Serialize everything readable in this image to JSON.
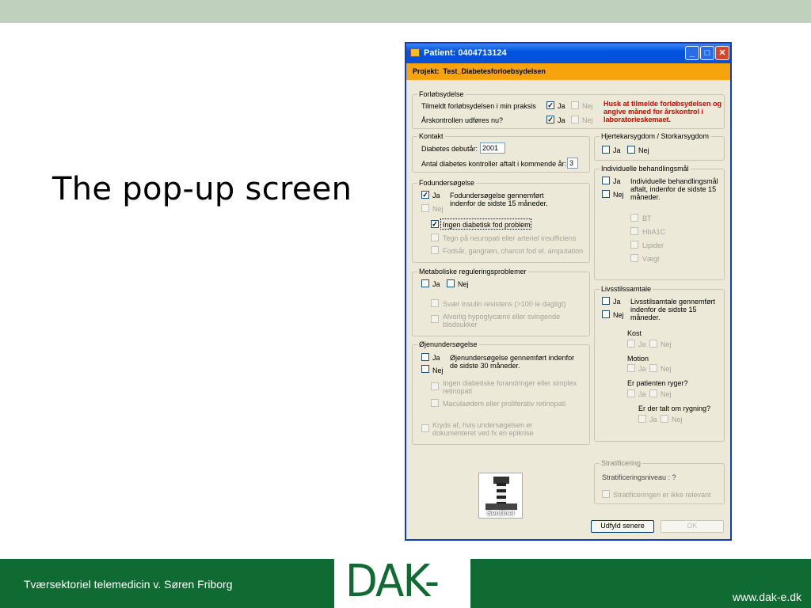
{
  "slide": {
    "title": "The pop-up screen",
    "footer_author": "Tværsektoriel telemedicin  v. Søren Friborg",
    "logo_text": "DAK-E",
    "footer_url": "www.dak-e.dk"
  },
  "window": {
    "title": "Patient: 0404713124",
    "project_label": "Projekt:",
    "project_name": "Test_Diabetesforloebsydelsen",
    "min_glyph": "_",
    "max_glyph": "□",
    "close_glyph": "✕"
  },
  "glyphs": {
    "check": "✓"
  },
  "forlob": {
    "legend": "Forløbsydelse",
    "q1": "Tilmeldt forløbsydelsen i min praksis",
    "q2": "Årskontrollen udføres nu?",
    "ja": "Ja",
    "nej": "Nej",
    "q1_ja": true,
    "q2_ja": true,
    "warning": "Husk at tilmelde forløbsydelsen og angive måned for årskontrol i laboratorieskemaet."
  },
  "kontakt": {
    "legend": "Kontakt",
    "debut_label": "Diabetes debutår:",
    "debut_value": "2001",
    "antal_label": "Antal diabetes kontroller aftalt i kommende år:",
    "antal_value": "3"
  },
  "fod": {
    "legend": "Fodundersøgelse",
    "ja": "Ja",
    "nej": "Nej",
    "ja_checked": true,
    "desc": "Fodundersøgelse gennemført indenfor de sidste 15 måneder.",
    "opt1": "Ingen diabetisk fod problem",
    "opt1_checked": true,
    "opt2": "Tegn på neuropati eller arteriel insufficiens",
    "opt3": "Fodsår, gangræn, charcot fod el. amputation"
  },
  "metab": {
    "legend": "Metaboliske reguleringsproblemer",
    "ja": "Ja",
    "nej": "Nej",
    "opt1": "Svær insulin resistens (>100 ie dagligt)",
    "opt2": "Alvorlig hypoglycæmi eller svingende blodsukker"
  },
  "ojen": {
    "legend": "Øjenundersøgelse",
    "ja": "Ja",
    "nej": "Nej",
    "desc": "Øjenundersøgelse gennemført indenfor de sidste 30 måneder.",
    "opt1": "Ingen diabetiske forandringer eller simplex retinopati",
    "opt2": "Maculaødem eller proliferativ retinopati",
    "opt3": "Kryds af, hvis undersøgelsen er dokumenteret ved fx en epikrise"
  },
  "hjerte": {
    "legend": "Hjertekarsygdom / Storkarsygdom",
    "ja": "Ja",
    "nej": "Nej"
  },
  "indiv": {
    "legend": "Individuelle behandlingsmål",
    "ja": "Ja",
    "nej": "Nej",
    "desc": "Individuelle behandlingsmål aftalt, indenfor de sidste 15 måneder.",
    "bt": "BT",
    "hba1c": "HbA1C",
    "lipider": "Lipider",
    "vaegt": "Vægt"
  },
  "livs": {
    "legend": "Livsstilssamtale",
    "ja": "Ja",
    "nej": "Nej",
    "desc": "Livsstilsamtale gennemført indenfor de sidste 15 måneder.",
    "kost": "Kost",
    "motion": "Motion",
    "ryger": "Er patienten ryger?",
    "talt": "Er der talt om rygning?"
  },
  "strat": {
    "legend": "Stratificering",
    "level": "Stratificeringsniveau : ?",
    "opt": "Stratificeringen er ikke relevant"
  },
  "sentinel_label": "Sentinel",
  "buttons": {
    "later": "Udfyld senere",
    "ok": "OK"
  }
}
